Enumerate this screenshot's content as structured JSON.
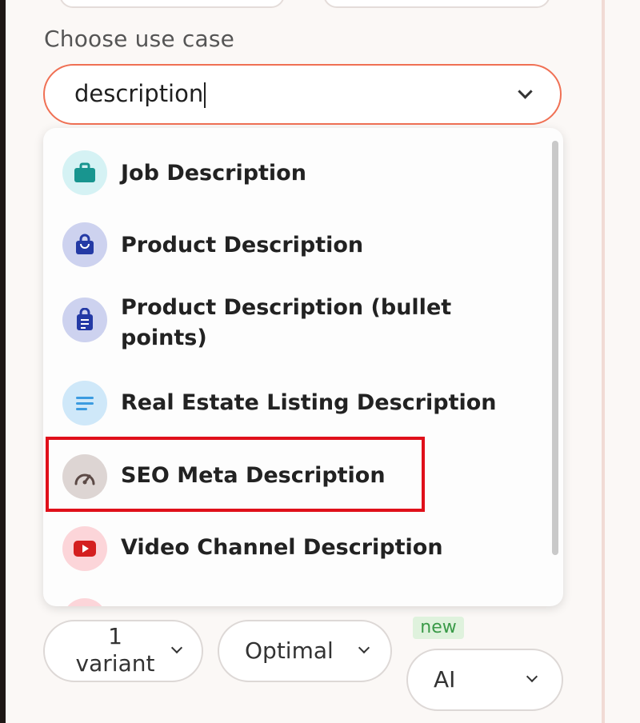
{
  "form": {
    "use_case_label": "Choose use case",
    "search_value": "description"
  },
  "dropdown": {
    "options": [
      {
        "label": "Job Description",
        "icon": "briefcase-icon"
      },
      {
        "label": "Product Description",
        "icon": "shopping-bag-icon"
      },
      {
        "label": "Product Description (bullet points)",
        "icon": "shopping-bag-list-icon"
      },
      {
        "label": "Real Estate Listing Description",
        "icon": "text-lines-icon"
      },
      {
        "label": "SEO Meta Description",
        "icon": "speedometer-icon"
      },
      {
        "label": "Video Channel Description",
        "icon": "video-play-icon"
      }
    ],
    "highlighted_option": "SEO Meta Description"
  },
  "controls": {
    "variants_line1": "1",
    "variants_line2": "variant",
    "quality": "Optimal",
    "new_badge": "new",
    "mode": "AI"
  },
  "colors": {
    "accent": "#f07054",
    "highlight": "#e0101a"
  }
}
